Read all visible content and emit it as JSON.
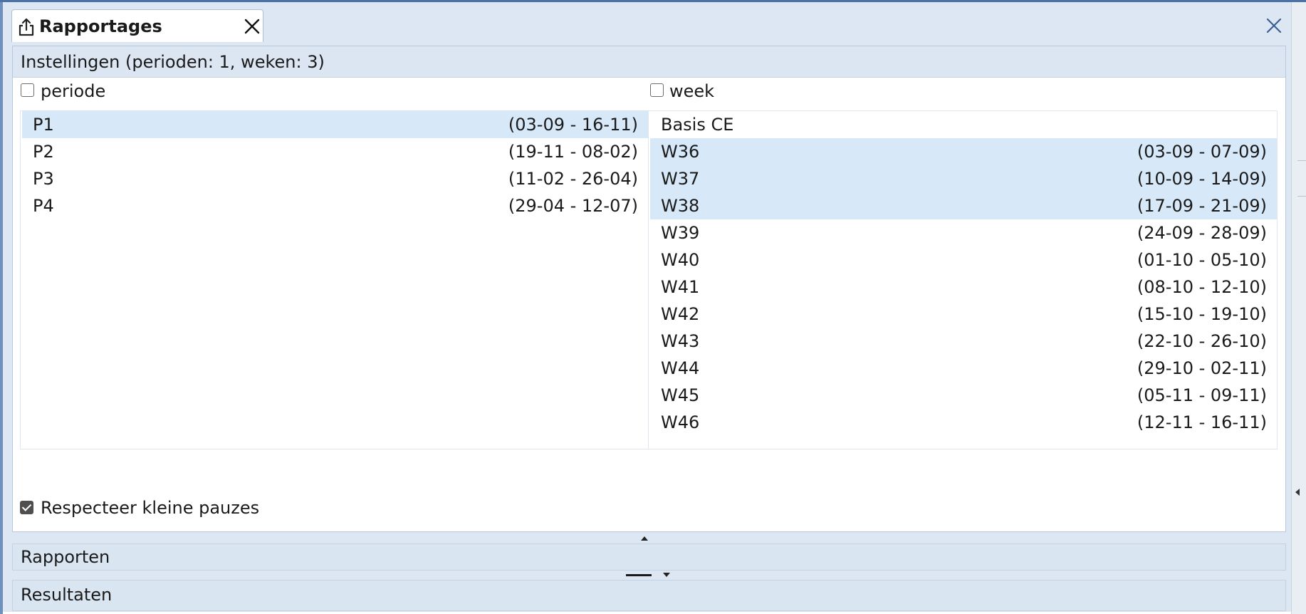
{
  "tab": {
    "title": "Rapportages",
    "icon": "export-icon"
  },
  "settings": {
    "header": "Instellingen (perioden: 1, weken: 3)",
    "periode_label": "periode",
    "periode_checked": false,
    "week_label": "week",
    "week_checked": false,
    "periods": [
      {
        "name": "P1",
        "range": "(03-09 - 16-11)",
        "selected": true
      },
      {
        "name": "P2",
        "range": "(19-11 - 08-02)",
        "selected": false
      },
      {
        "name": "P3",
        "range": "(11-02 - 26-04)",
        "selected": false
      },
      {
        "name": "P4",
        "range": "(29-04 - 12-07)",
        "selected": false
      }
    ],
    "weeks_group": "Basis CE",
    "weeks": [
      {
        "name": "W36",
        "range": "(03-09 - 07-09)",
        "selected": true
      },
      {
        "name": "W37",
        "range": "(10-09 - 14-09)",
        "selected": true
      },
      {
        "name": "W38",
        "range": "(17-09 - 21-09)",
        "selected": true
      },
      {
        "name": "W39",
        "range": "(24-09 - 28-09)",
        "selected": false
      },
      {
        "name": "W40",
        "range": "(01-10 - 05-10)",
        "selected": false
      },
      {
        "name": "W41",
        "range": "(08-10 - 12-10)",
        "selected": false
      },
      {
        "name": "W42",
        "range": "(15-10 - 19-10)",
        "selected": false
      },
      {
        "name": "W43",
        "range": "(22-10 - 26-10)",
        "selected": false
      },
      {
        "name": "W44",
        "range": "(29-10 - 02-11)",
        "selected": false
      },
      {
        "name": "W45",
        "range": "(05-11 - 09-11)",
        "selected": false
      },
      {
        "name": "W46",
        "range": "(12-11 - 16-11)",
        "selected": false
      }
    ],
    "respect_label": "Respecteer kleine pauzes",
    "respect_checked": true
  },
  "sections": {
    "reports": "Rapporten",
    "results": "Resultaten"
  },
  "colors": {
    "selected_row": "#d7e8f8",
    "header_bg": "#dbe6f2",
    "frame": "#4a72a8"
  }
}
